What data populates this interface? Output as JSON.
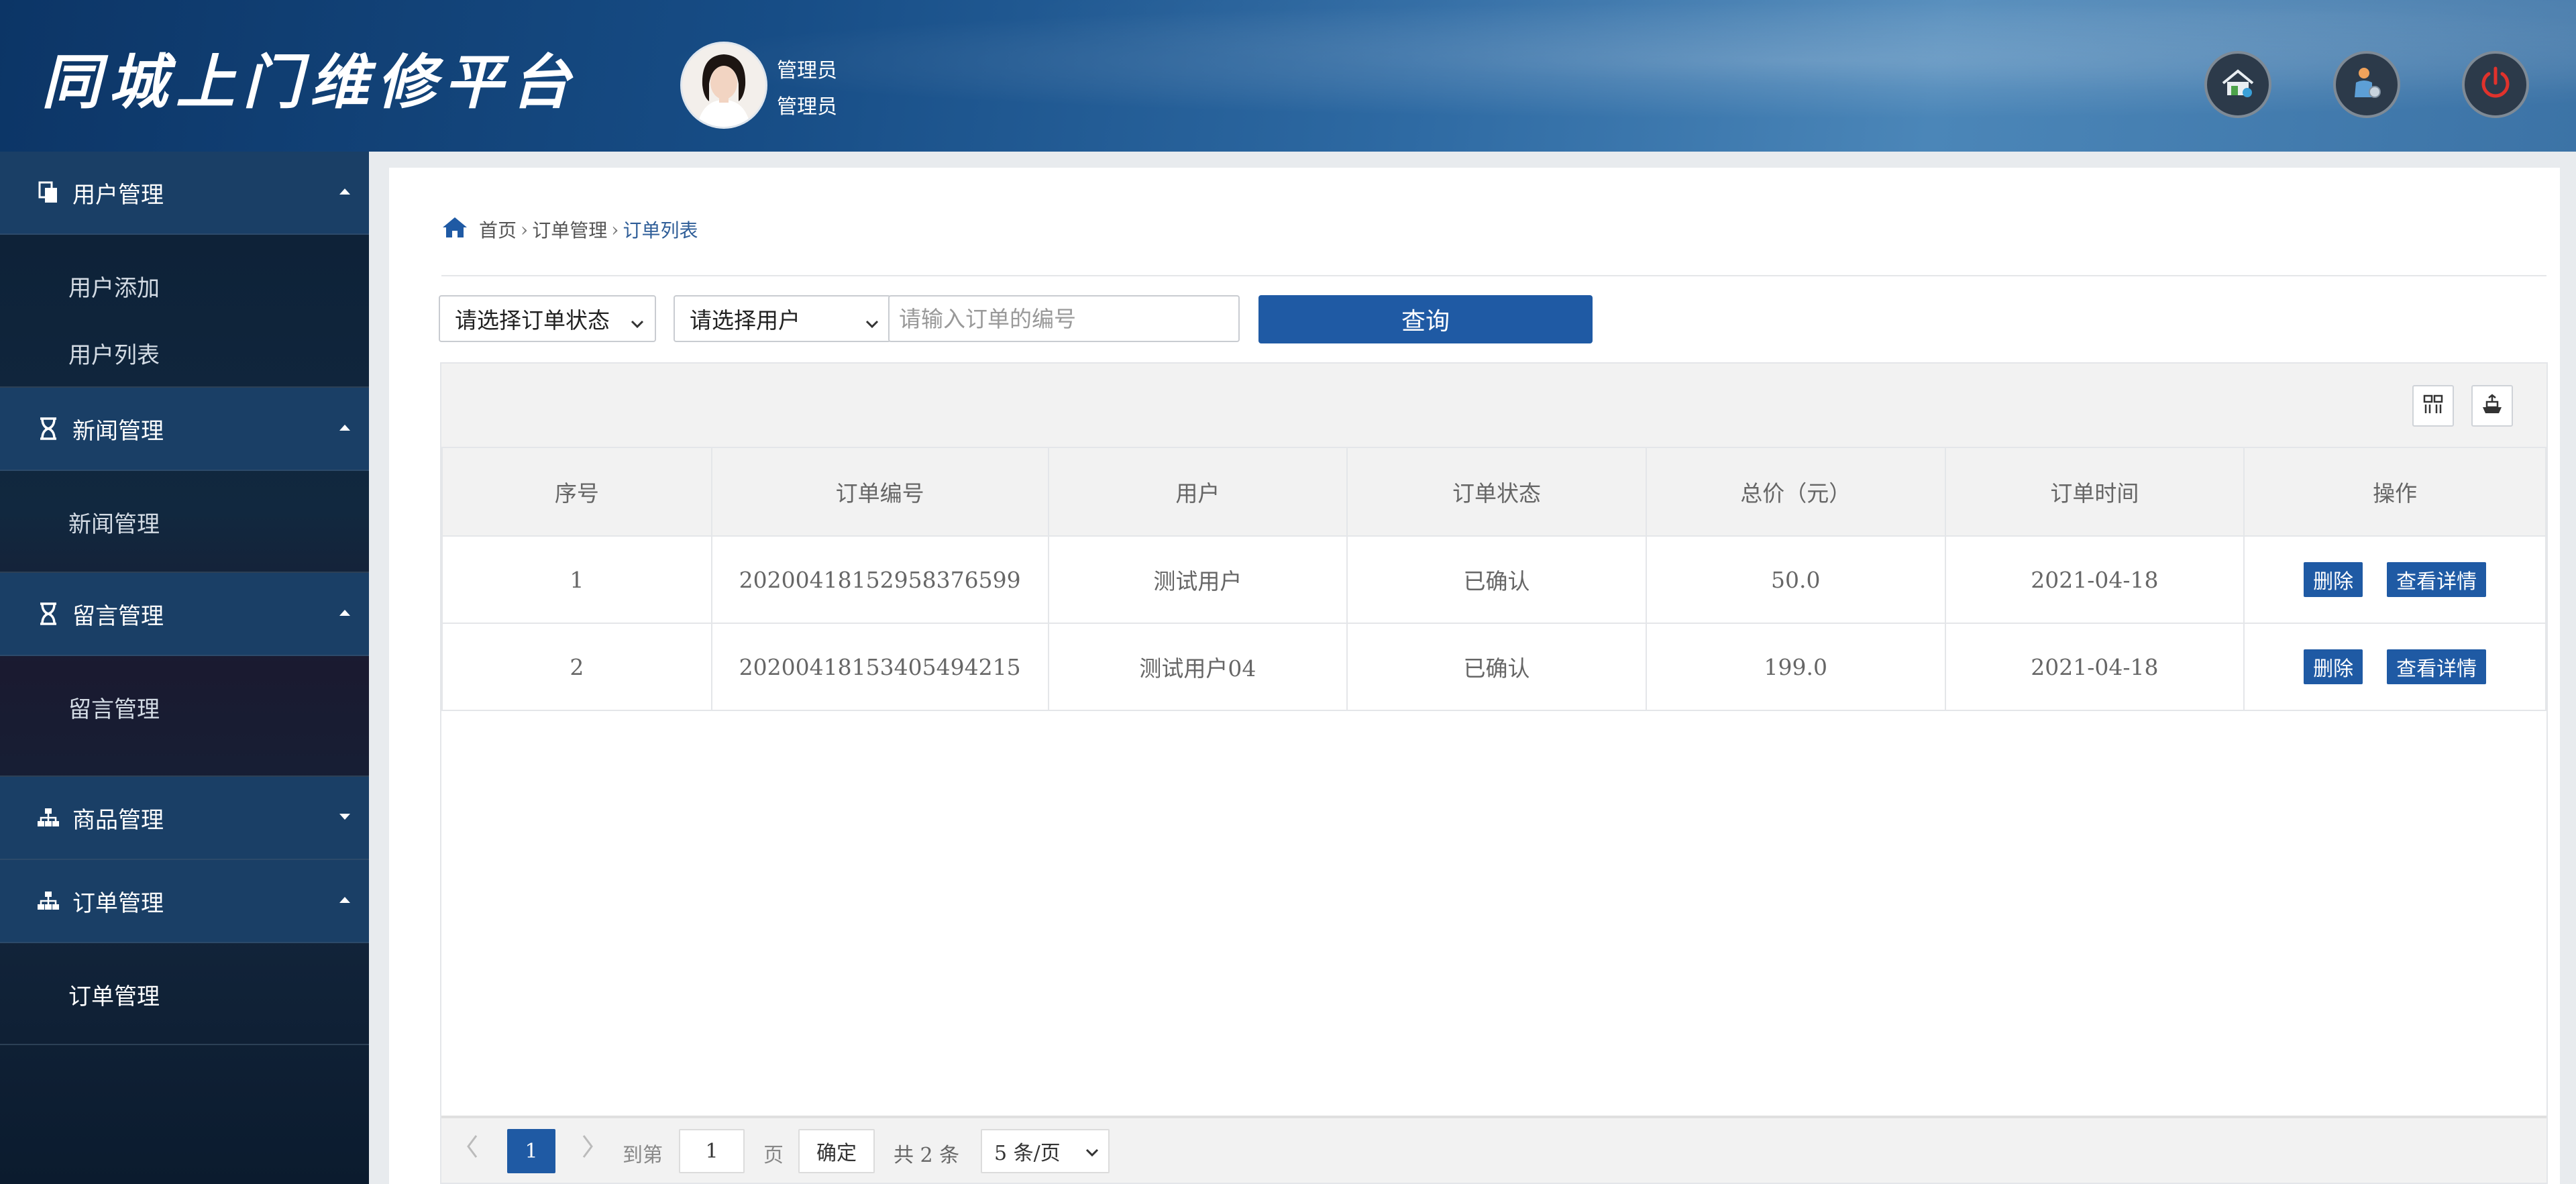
{
  "header": {
    "app_title": "同城上门维修平台",
    "user_name": "管理员",
    "user_role": "管理员",
    "buttons": [
      {
        "icon": "home-icon"
      },
      {
        "icon": "user-settings-icon"
      },
      {
        "icon": "power-icon"
      }
    ]
  },
  "sidebar": {
    "menus": [
      {
        "label": "用户管理",
        "icon": "copy-icon",
        "expanded": true,
        "items": [
          "用户添加",
          "用户列表"
        ]
      },
      {
        "label": "新闻管理",
        "icon": "hourglass-icon",
        "expanded": true,
        "items": [
          "新闻管理"
        ]
      },
      {
        "label": "留言管理",
        "icon": "hourglass-icon",
        "expanded": true,
        "items": [
          "留言管理"
        ]
      },
      {
        "label": "商品管理",
        "icon": "sitemap-icon",
        "expanded": false,
        "items": []
      },
      {
        "label": "订单管理",
        "icon": "sitemap-icon",
        "expanded": true,
        "items": [
          "订单管理"
        ]
      }
    ]
  },
  "breadcrumb": {
    "items": [
      "首页",
      "订单管理",
      "订单列表"
    ]
  },
  "filters": {
    "status_select": "请选择订单状态",
    "user_select": "请选择用户",
    "order_no_placeholder": "请输入订单的编号",
    "query_label": "查询"
  },
  "table": {
    "columns": [
      "序号",
      "订单编号",
      "用户",
      "订单状态",
      "总价（元）",
      "订单时间",
      "操作"
    ],
    "rows": [
      {
        "index": "1",
        "order_no": "20200418152958376599",
        "user": "测试用户",
        "status": "已确认",
        "total": "50.0",
        "time": "2021-04-18"
      },
      {
        "index": "2",
        "order_no": "20200418153405494215",
        "user": "测试用户04",
        "status": "已确认",
        "total": "199.0",
        "time": "2021-04-18"
      }
    ],
    "delete_label": "删除",
    "detail_label": "查看详情"
  },
  "pager": {
    "current_page": "1",
    "goto_prefix": "到第",
    "goto_value": "1",
    "goto_suffix": "页",
    "confirm_label": "确定",
    "total_text": "共 2 条",
    "page_size": "5 条/页"
  },
  "colors": {
    "accent": "#1f5aa4",
    "sidebar_head": "#1a3f66"
  }
}
